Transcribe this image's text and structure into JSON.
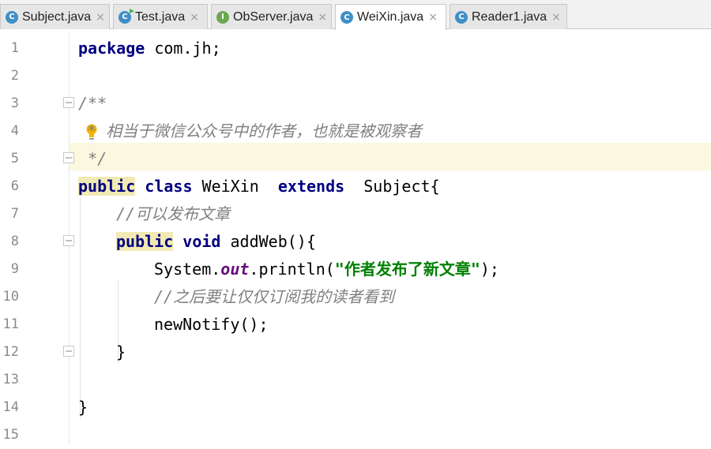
{
  "tabs": [
    {
      "label": "Subject.java",
      "icon": "class",
      "active": false
    },
    {
      "label": "Test.java",
      "icon": "class-runnable",
      "active": false
    },
    {
      "label": "ObServer.java",
      "icon": "interface",
      "active": false
    },
    {
      "label": "WeiXin.java",
      "icon": "class",
      "active": true
    },
    {
      "label": "Reader1.java",
      "icon": "class",
      "active": false
    }
  ],
  "tab_close_glyph": "×",
  "icon_letters": {
    "class": "C",
    "interface": "I"
  },
  "editor": {
    "current_line": 5,
    "lines": [
      {
        "n": "1"
      },
      {
        "n": "2"
      },
      {
        "n": "3"
      },
      {
        "n": "4"
      },
      {
        "n": "5"
      },
      {
        "n": "6"
      },
      {
        "n": "7"
      },
      {
        "n": "8"
      },
      {
        "n": "9"
      },
      {
        "n": "10"
      },
      {
        "n": "11"
      },
      {
        "n": "12"
      },
      {
        "n": "13"
      },
      {
        "n": "14"
      },
      {
        "n": "15"
      }
    ],
    "code": {
      "l1_kw": "package",
      "l1_rest": " com.jh;",
      "l3": "/**",
      "l4": "* 相当于微信公众号中的作者，也就是被观察者",
      "l5": " */",
      "l6_kw1": "public",
      "l6_kw2": "class",
      "l6_name": " WeiXin  ",
      "l6_kw3": "extends",
      "l6_rest": "  Subject{",
      "l7": "//可以发布文章",
      "l8_kw1": "public",
      "l8_kw2": "void",
      "l8_rest": " addWeb(){",
      "l9_a": "System.",
      "l9_field": "out",
      "l9_b": ".println(",
      "l9_str": "\"作者发布了新文章\"",
      "l9_c": ");",
      "l10": "//之后要让仅仅订阅我的读者看到",
      "l11": "newNotify();",
      "l12": "}",
      "l14": "}"
    }
  },
  "colors": {
    "keyword": "#000080",
    "comment": "#808080",
    "string": "#008000",
    "field": "#660e7a",
    "current_line_bg": "#fcf8df",
    "class_icon": "#3f8fc7",
    "interface_icon": "#6aa84f"
  }
}
